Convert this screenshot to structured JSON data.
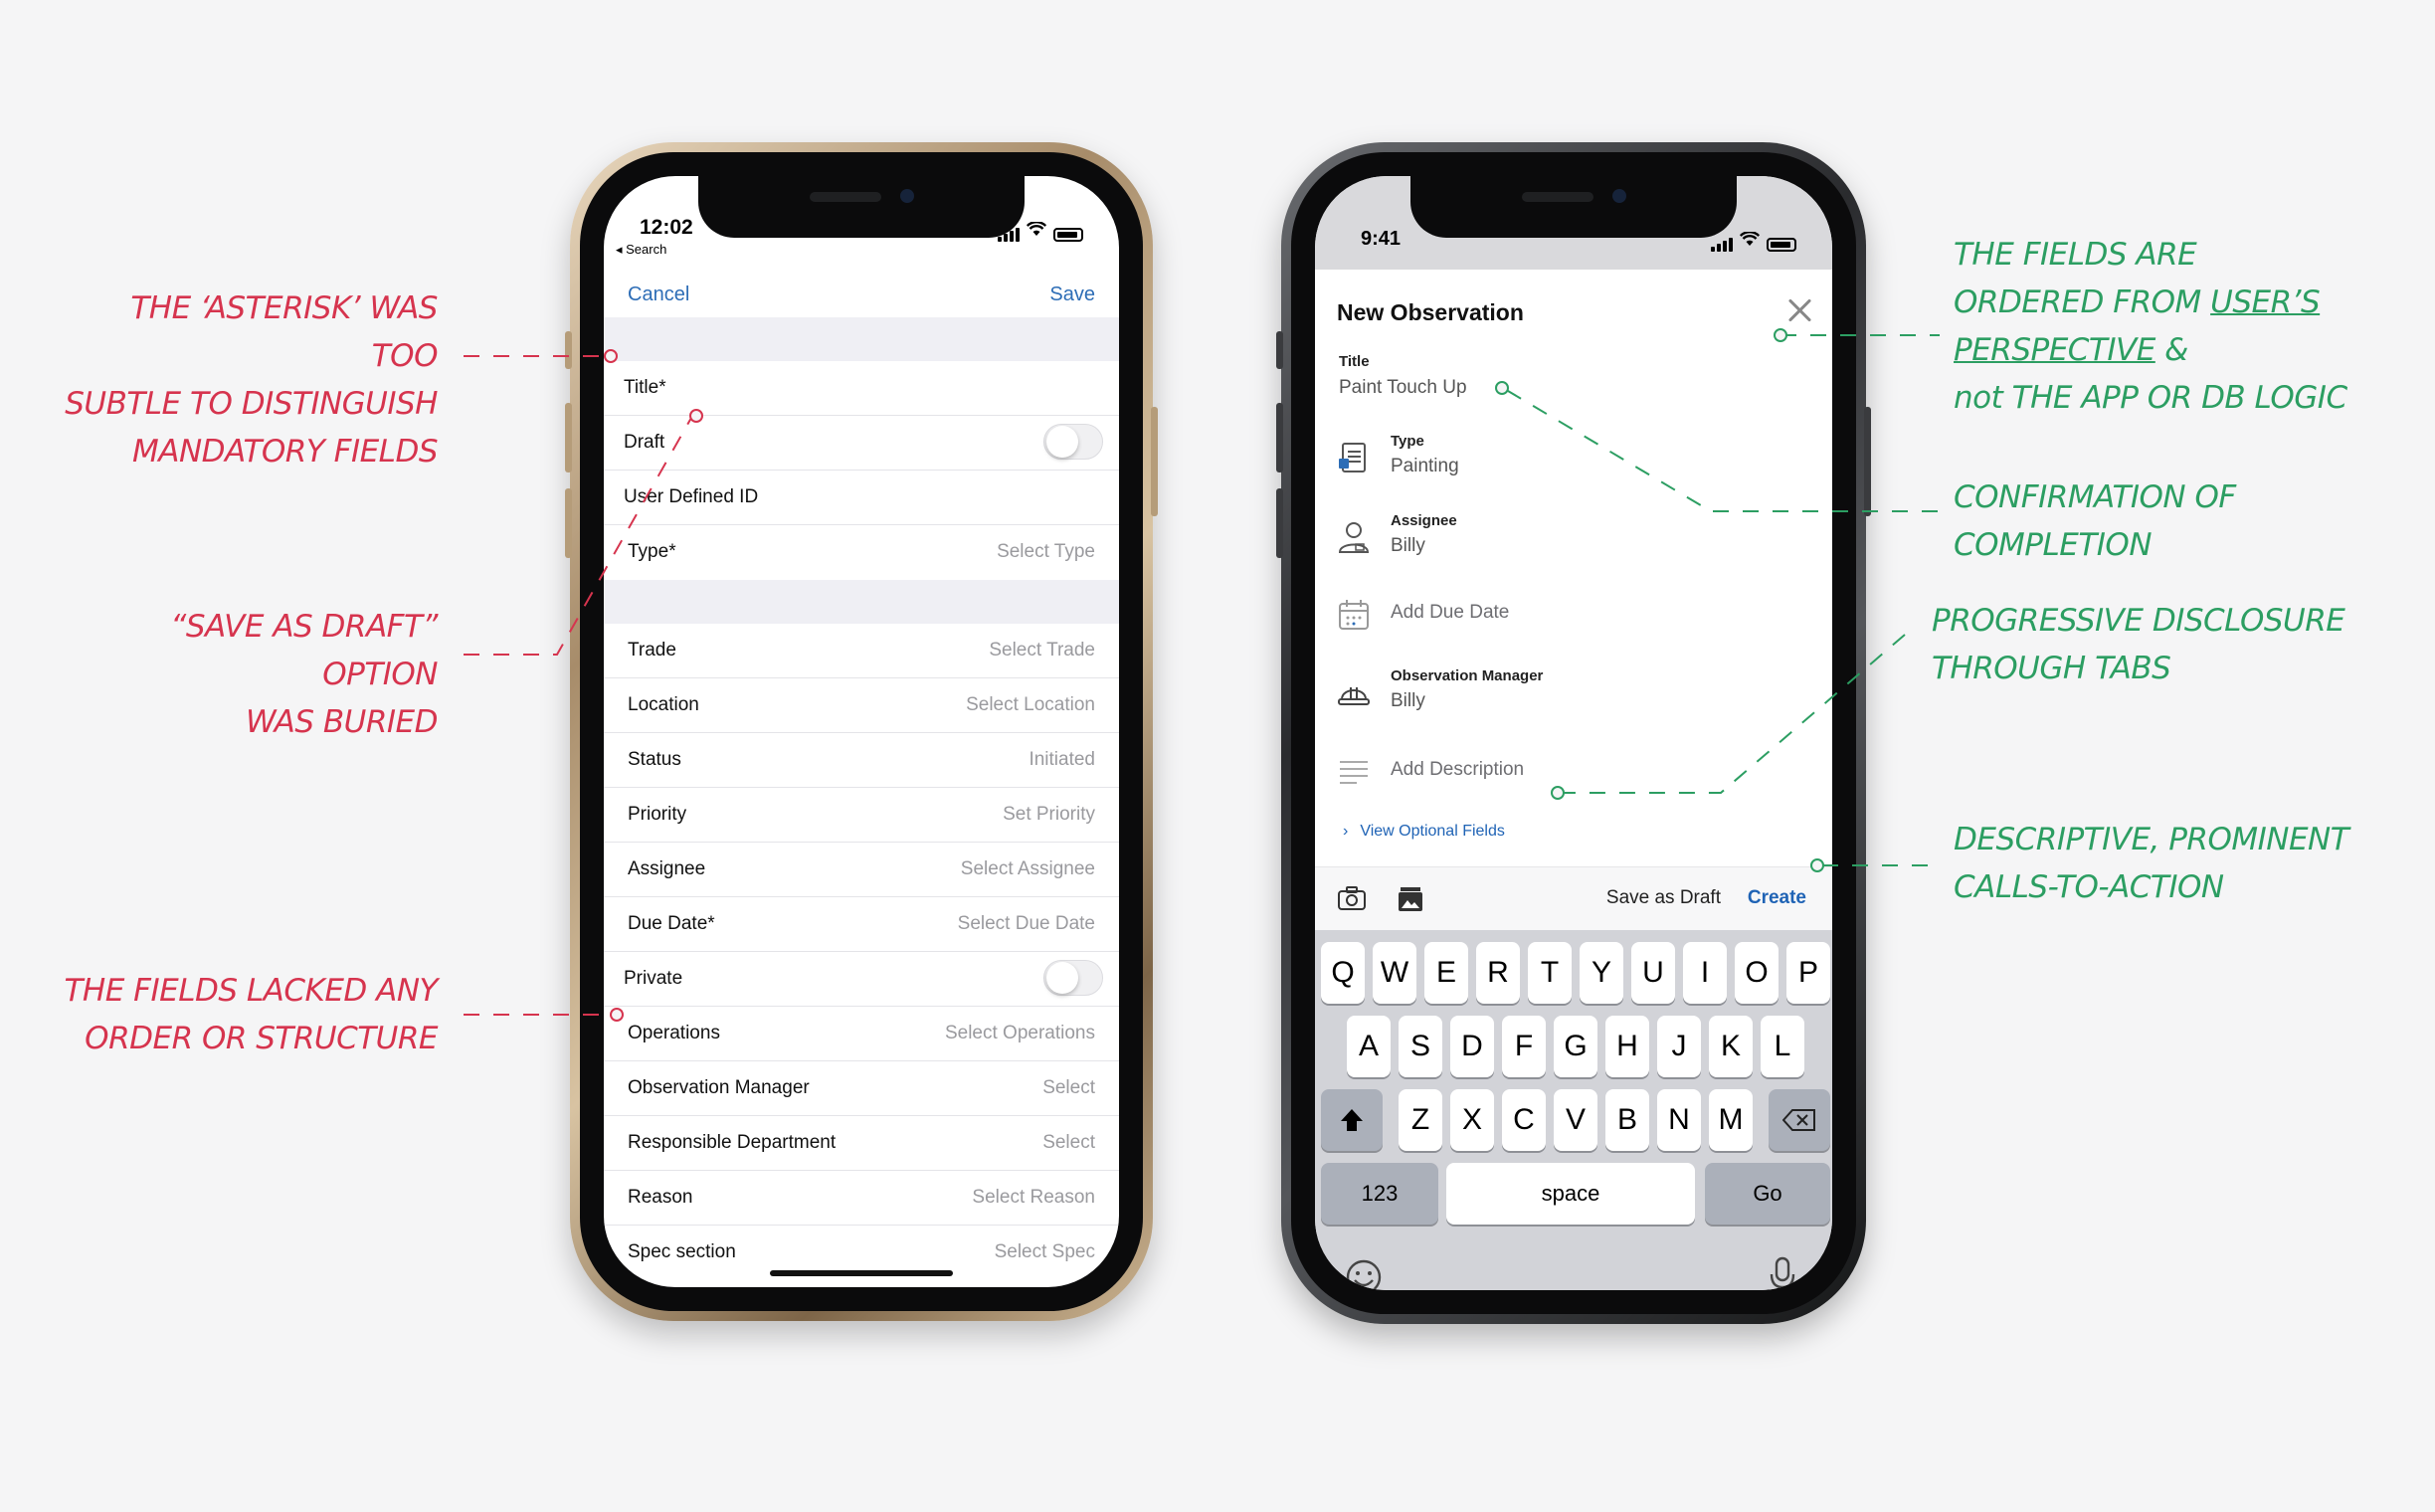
{
  "old_phone": {
    "status_time": "12:02",
    "back_label": "◂ Search",
    "nav": {
      "cancel": "Cancel",
      "save": "Save"
    },
    "rows": [
      {
        "label": "Title*",
        "value": ""
      },
      {
        "label": "Draft",
        "value": "",
        "toggle": true
      },
      {
        "label": "User Defined ID",
        "value": ""
      },
      {
        "label": "Type*",
        "value": "Select Type"
      },
      {
        "label": "Trade",
        "value": "Select Trade"
      },
      {
        "label": "Location",
        "value": "Select Location"
      },
      {
        "label": "Status",
        "value": "Initiated"
      },
      {
        "label": "Priority",
        "value": "Set Priority"
      },
      {
        "label": "Assignee",
        "value": "Select Assignee"
      },
      {
        "label": "Due Date*",
        "value": "Select Due Date"
      },
      {
        "label": "Private",
        "value": "",
        "toggle": true
      },
      {
        "label": "Operations",
        "value": "Select Operations"
      },
      {
        "label": "Observation Manager",
        "value": "Select"
      },
      {
        "label": "Responsible Department",
        "value": "Select"
      },
      {
        "label": "Reason",
        "value": "Select Reason"
      },
      {
        "label": "Spec section",
        "value": "Select Spec"
      }
    ]
  },
  "new_phone": {
    "status_time": "9:41",
    "sheet_title": "New Observation",
    "title_field": {
      "label": "Title",
      "value": "Paint Touch Up"
    },
    "fields": [
      {
        "icon": "document-type-icon",
        "label": "Type",
        "value": "Painting"
      },
      {
        "icon": "person-icon",
        "label": "Assignee",
        "value": "Billy"
      },
      {
        "icon": "calendar-icon",
        "label": "",
        "placeholder": "Add Due Date"
      },
      {
        "icon": "hard-hat-icon",
        "label": "Observation Manager",
        "value": "Billy"
      },
      {
        "icon": "text-lines-icon",
        "label": "",
        "placeholder": "Add Description"
      }
    ],
    "optional_fields_link": "View Optional Fields",
    "toolbar": {
      "save_draft": "Save as Draft",
      "create": "Create"
    },
    "keyboard": {
      "row1": [
        "Q",
        "W",
        "E",
        "R",
        "T",
        "Y",
        "U",
        "I",
        "O",
        "P"
      ],
      "row2": [
        "A",
        "S",
        "D",
        "F",
        "G",
        "H",
        "J",
        "K",
        "L"
      ],
      "row3": [
        "Z",
        "X",
        "C",
        "V",
        "B",
        "N",
        "M"
      ],
      "numbers": "123",
      "space": "space",
      "go": "Go"
    }
  },
  "annotations": {
    "left": [
      [
        "THE ‘ASTERISK’ WAS TOO",
        "SUBTLE TO DISTINGUISH",
        "MANDATORY  FIELDS"
      ],
      [
        "“SAVE AS DRAFT” OPTION",
        "WAS BURIED"
      ],
      [
        "THE FIELDS LACKED ANY",
        "ORDER OR STRUCTURE"
      ]
    ],
    "right_1": {
      "line1": "THE FIELDS  ARE",
      "line2a": "ORDERED FROM ",
      "line2b": "USER’S",
      "line3a": "PERSPECTIVE",
      "line3b": " &",
      "line4a": "not",
      "line4b": " THE APP or DB LOGIC"
    },
    "right_2": [
      "CONFIRMATION OF",
      "COMPLETION"
    ],
    "right_3": [
      "PROGRESSIVE DISCLOSURE",
      "THROUGH TABS"
    ],
    "right_4": [
      "DESCRIPTIVE, PROMINENT",
      "CALLS-TO-ACTION"
    ]
  },
  "colors": {
    "annotation_red": "#d6344e",
    "annotation_green": "#2c9e62",
    "link_blue": "#2d6db6"
  }
}
